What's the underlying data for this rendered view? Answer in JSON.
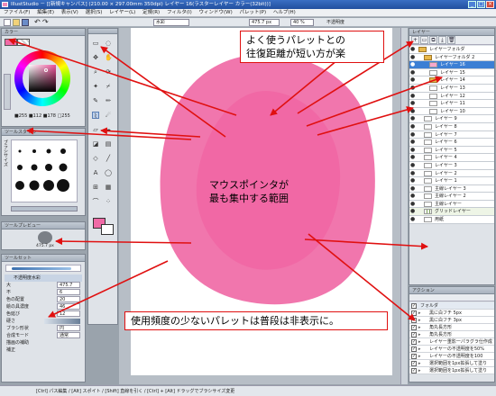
{
  "window": {
    "title": "IllustStudio － [[新規キャンバス] (210.00 × 297.00mm 350dpi) レイヤー 16(ラスターレイヤー カラー(32bit))]"
  },
  "menu": [
    "ファイル(F)",
    "編集(E)",
    "表示(V)",
    "選択(S)",
    "レイヤー(L)",
    "定規(R)",
    "フィルタ(I)",
    "ウィンドウ(W)",
    "パレット(P)",
    "ヘルプ(H)"
  ],
  "toolbar": {
    "zoom": "475.7 px",
    "angle": "40 %",
    "blend_label": "不透明度",
    "mode": "水彩"
  },
  "color_panel": {
    "title": "カラー",
    "rgb_readout": "■255 ■112 ■178 □255"
  },
  "tool_style_panel": {
    "title": "ツールスタイル",
    "size_label": "ブラシサイズ"
  },
  "tool_preview_panel": {
    "title": "ツールプレビュー",
    "size_value": "475.7 px"
  },
  "tool_settings_panel": {
    "title": "ツールセット",
    "rows": [
      {
        "label": "不透明度水彩",
        "value": ""
      },
      {
        "label": "大",
        "value": "475.7"
      },
      {
        "label": "不",
        "value": "6"
      },
      {
        "label": "色の配置",
        "value": "20"
      },
      {
        "label": "絵の具濃度",
        "value": "46"
      },
      {
        "label": "色延び",
        "value": "12"
      },
      {
        "label": "硬さ",
        "value": ""
      },
      {
        "label": "ブラシ形状",
        "value": "円"
      },
      {
        "label": "合成モード",
        "value": "通常"
      },
      {
        "label": "描画の補助",
        "value": ""
      },
      {
        "label": "補正",
        "value": ""
      }
    ]
  },
  "layers_panel": {
    "title": "レイヤー",
    "layers": [
      {
        "name": "レイヤーフォルダ",
        "indent": 0,
        "folder": true,
        "selected": false
      },
      {
        "name": "レイヤーフォルダ 2",
        "indent": 1,
        "folder": true,
        "selected": false
      },
      {
        "name": "レイヤー 16",
        "indent": 2,
        "folder": false,
        "selected": true
      },
      {
        "name": "レイヤー 15",
        "indent": 2,
        "folder": false,
        "selected": false
      },
      {
        "name": "レイヤー 14",
        "indent": 2,
        "folder": true,
        "selected": false
      },
      {
        "name": "レイヤー 13",
        "indent": 2,
        "folder": false,
        "selected": false
      },
      {
        "name": "レイヤー 12",
        "indent": 2,
        "folder": false,
        "selected": false
      },
      {
        "name": "レイヤー 11",
        "indent": 2,
        "folder": false,
        "selected": false
      },
      {
        "name": "レイヤー 10",
        "indent": 2,
        "folder": false,
        "selected": false
      },
      {
        "name": "レイヤー 9",
        "indent": 1,
        "folder": false,
        "selected": false
      },
      {
        "name": "レイヤー 8",
        "indent": 1,
        "folder": false,
        "selected": false
      },
      {
        "name": "レイヤー 7",
        "indent": 1,
        "folder": false,
        "selected": false
      },
      {
        "name": "レイヤー 6",
        "indent": 1,
        "folder": false,
        "selected": false
      },
      {
        "name": "レイヤー 5",
        "indent": 1,
        "folder": false,
        "selected": false
      },
      {
        "name": "レイヤー 4",
        "indent": 1,
        "folder": false,
        "selected": false
      },
      {
        "name": "レイヤー 3",
        "indent": 1,
        "folder": false,
        "selected": false
      },
      {
        "name": "レイヤー 2",
        "indent": 1,
        "folder": false,
        "selected": false
      },
      {
        "name": "レイヤー 1",
        "indent": 1,
        "folder": false,
        "selected": false
      },
      {
        "name": "主線レイヤー 3",
        "indent": 1,
        "folder": false,
        "selected": false
      },
      {
        "name": "主線レイヤー 2",
        "indent": 1,
        "folder": false,
        "selected": false
      },
      {
        "name": "主線レイヤー",
        "indent": 1,
        "folder": false,
        "selected": false
      }
    ],
    "grid_layer": "グリッドレイヤー",
    "paper_layer": "用紙"
  },
  "actions_panel": {
    "title": "アクション",
    "folder": "フォルダ",
    "items": [
      "黒に白フチ 5px",
      "黒に白フチ 3px",
      "角丸長方形",
      "角丸長方形",
      "レイヤー重影一パラグラ仕作成",
      "レイヤーの不透明度を50%",
      "レイヤーの不透明度を100",
      "選択範囲を1px拡張して塗り",
      "選択範囲を1px拡張して塗り"
    ]
  },
  "status_bar": "[Ctrl] パス編集 / [Alt] スポイト / [Shift] 直線を引く / [Ctrl] + [Alt] ドラッグでブラシサイズ変更",
  "callouts": {
    "top_line1": "よく使うパレットとの",
    "top_line2": "往復距離が短い方が楽",
    "center_line1": "マウスポインタが",
    "center_line2": "最も集中する範囲",
    "bottom": "使用頻度の少ないパレットは普段は非表示に。"
  },
  "colors": {
    "accent_red": "#e01010",
    "blob_pink": "#f06aa6",
    "selected_layer": "#3c7fd4",
    "panel_bg": "#dfe3e8"
  }
}
